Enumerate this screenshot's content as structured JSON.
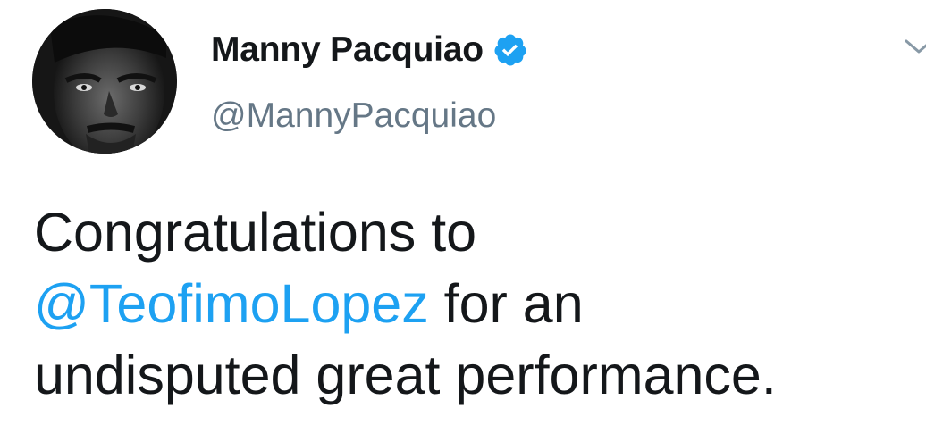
{
  "author": {
    "display_name": "Manny Pacquiao",
    "handle": "@MannyPacquiao",
    "verified": true,
    "avatar_icon": "profile-photo"
  },
  "tweet": {
    "line1": "Congratulations to",
    "mention": "@TeofimoLopez",
    "line2_rest": " for an",
    "line3": "undisputed great performance."
  },
  "icons": {
    "verified": "verified-badge-icon",
    "menu": "chevron-down-icon"
  },
  "colors": {
    "mention": "#1da1f2",
    "verified": "#1da1f2",
    "handle": "#657786",
    "text": "#14171a"
  }
}
